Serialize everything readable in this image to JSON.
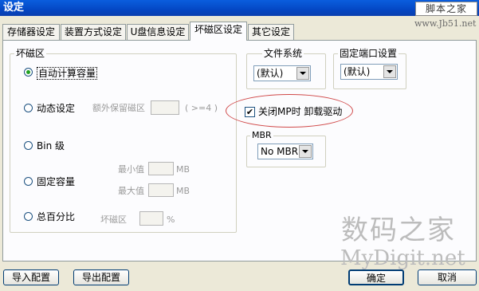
{
  "window": {
    "title": "设定"
  },
  "brand": {
    "logo": "脚本之家",
    "site": "www.Jb51.net"
  },
  "tabs": [
    {
      "label": "存储器设定",
      "active": false
    },
    {
      "label": "装置方式设定",
      "active": false
    },
    {
      "label": "U盘信息设定",
      "active": false
    },
    {
      "label": "坏磁区设定",
      "active": true
    },
    {
      "label": "其它设定",
      "active": false
    }
  ],
  "bad_sector": {
    "legend": "坏磁区",
    "options": {
      "auto": "自动计算容量",
      "dynamic": "动态设定",
      "bin": "Bin 级",
      "fixed": "固定容量",
      "percent": "总百分比"
    },
    "selected": "auto",
    "reserve_label": "额外保留磁区",
    "reserve_hint": "( >=4 )",
    "min_label": "最小值",
    "max_label": "最大值",
    "mb_unit": "MB",
    "bad_label": "坏磁区",
    "percent_unit": "%"
  },
  "filesystem": {
    "legend": "文件系统",
    "value": "(默认)"
  },
  "port": {
    "legend": "固定端口设置",
    "value": "(默认)"
  },
  "mp_driver": {
    "label": "关闭MP时 卸载驱动",
    "checked": true,
    "highlight_color": "#d04848"
  },
  "mbr": {
    "legend": "MBR",
    "value": "No MBR"
  },
  "buttons": {
    "import": "导入配置",
    "export": "导出配置",
    "ok": "确定",
    "cancel": "取消"
  },
  "watermark": {
    "line1": "数码之家",
    "line2": "MyDigit.net"
  }
}
